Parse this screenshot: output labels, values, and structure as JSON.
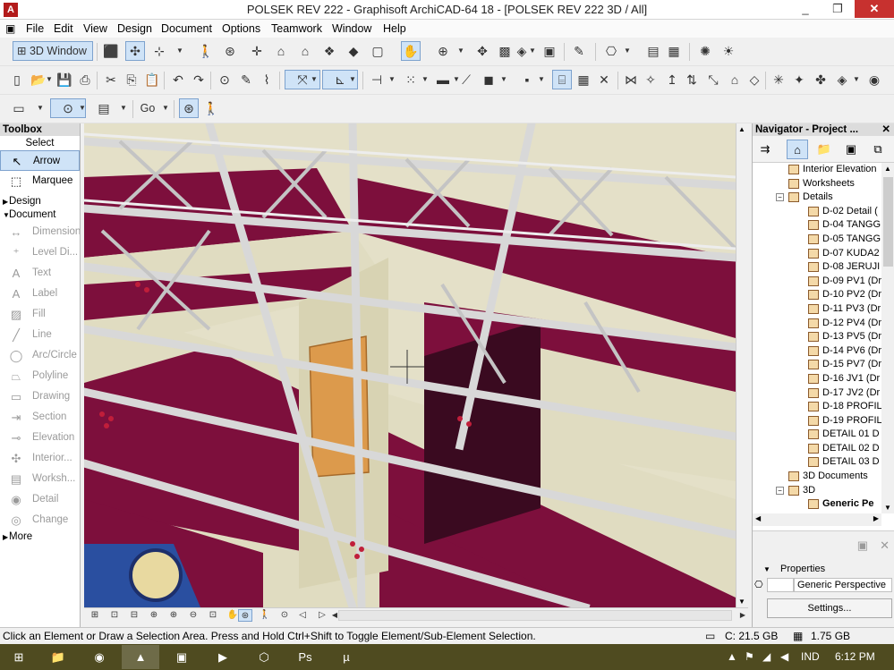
{
  "window": {
    "title": "POLSEK REV 222 - Graphisoft ArchiCAD-64 18 - [POLSEK REV 222 3D / All]",
    "app_icon": "archicad-icon",
    "controls": [
      "_",
      "❐",
      "✕"
    ]
  },
  "menu": [
    "File",
    "Edit",
    "View",
    "Design",
    "Document",
    "Options",
    "Teamwork",
    "Window",
    "Help"
  ],
  "toolbar": {
    "view_button": "3D Window",
    "go_label": "Go"
  },
  "toolbox": {
    "title": "Toolbox",
    "select_label": "Select",
    "select_tools": [
      {
        "label": "Arrow",
        "icon": "arrow-icon",
        "glyph": "↖",
        "selected": true
      },
      {
        "label": "Marquee",
        "icon": "marquee-icon",
        "glyph": "⬚",
        "selected": false
      }
    ],
    "groups": {
      "design": "Design",
      "document": "Document",
      "more": "More"
    },
    "document_tools": [
      {
        "label": "Dimension",
        "icon": "dimension-icon",
        "glyph": "↔"
      },
      {
        "label": "Level Di...",
        "icon": "level-dimension-icon",
        "glyph": "⁺"
      },
      {
        "label": "Text",
        "icon": "text-icon",
        "glyph": "A"
      },
      {
        "label": "Label",
        "icon": "label-icon",
        "glyph": "A"
      },
      {
        "label": "Fill",
        "icon": "fill-icon",
        "glyph": "▨"
      },
      {
        "label": "Line",
        "icon": "line-icon",
        "glyph": "╱"
      },
      {
        "label": "Arc/Circle",
        "icon": "circle-icon",
        "glyph": "◯"
      },
      {
        "label": "Polyline",
        "icon": "polyline-icon",
        "glyph": "⏢"
      },
      {
        "label": "Drawing",
        "icon": "drawing-icon",
        "glyph": "▭"
      },
      {
        "label": "Section",
        "icon": "section-icon",
        "glyph": "⇥"
      },
      {
        "label": "Elevation",
        "icon": "elevation-icon",
        "glyph": "⊸"
      },
      {
        "label": "Interior...",
        "icon": "interior-elevation-icon",
        "glyph": "✣"
      },
      {
        "label": "Worksh...",
        "icon": "worksheet-icon",
        "glyph": "▤"
      },
      {
        "label": "Detail",
        "icon": "detail-icon",
        "glyph": "◉"
      },
      {
        "label": "Change",
        "icon": "change-icon",
        "glyph": "◎"
      }
    ]
  },
  "navigator": {
    "title": "Navigator - Project ...",
    "tree": [
      {
        "label": "Interior Elevation",
        "level": 1,
        "toggle": ""
      },
      {
        "label": "Worksheets",
        "level": 1,
        "toggle": ""
      },
      {
        "label": "Details",
        "level": 1,
        "toggle": "−"
      },
      {
        "label": "D-02 Detail (",
        "level": 2,
        "toggle": ""
      },
      {
        "label": "D-04 TANGG",
        "level": 2,
        "toggle": ""
      },
      {
        "label": "D-05 TANGG",
        "level": 2,
        "toggle": ""
      },
      {
        "label": "D-07 KUDA2",
        "level": 2,
        "toggle": ""
      },
      {
        "label": "D-08 JERUJI",
        "level": 2,
        "toggle": ""
      },
      {
        "label": "D-09 PV1 (Dr",
        "level": 2,
        "toggle": ""
      },
      {
        "label": "D-10 PV2 (Dr",
        "level": 2,
        "toggle": ""
      },
      {
        "label": "D-11 PV3 (Dr",
        "level": 2,
        "toggle": ""
      },
      {
        "label": "D-12 PV4 (Dr",
        "level": 2,
        "toggle": ""
      },
      {
        "label": "D-13 PV5 (Dr",
        "level": 2,
        "toggle": ""
      },
      {
        "label": "D-14 PV6 (Dr",
        "level": 2,
        "toggle": ""
      },
      {
        "label": "D-15 PV7 (Dr",
        "level": 2,
        "toggle": ""
      },
      {
        "label": "D-16 JV1 (Dr",
        "level": 2,
        "toggle": ""
      },
      {
        "label": "D-17 JV2 (Dr",
        "level": 2,
        "toggle": ""
      },
      {
        "label": "D-18 PROFIL",
        "level": 2,
        "toggle": ""
      },
      {
        "label": "D-19 PROFIL",
        "level": 2,
        "toggle": ""
      },
      {
        "label": "DETAIL 01 D",
        "level": 2,
        "toggle": ""
      },
      {
        "label": "DETAIL 02 D",
        "level": 2,
        "toggle": ""
      },
      {
        "label": "DETAIL 03 D",
        "level": 2,
        "toggle": ""
      },
      {
        "label": "3D Documents",
        "level": 1,
        "toggle": ""
      },
      {
        "label": "3D",
        "level": 1,
        "toggle": "−"
      },
      {
        "label": "Generic Pe",
        "level": 2,
        "toggle": "",
        "bold": true
      }
    ],
    "properties_label": "Properties",
    "view_name": "Generic Perspective",
    "settings_button": "Settings..."
  },
  "status": {
    "message": "Click an Element or Draw a Selection Area. Press and Hold Ctrl+Shift to Toggle Element/Sub-Element Selection.",
    "disk_free": "C: 21.5 GB",
    "memory": "1.75 GB"
  },
  "taskbar": {
    "apps": [
      "file-explorer-icon",
      "firefox-icon",
      "archicad-icon",
      "powerpoint-icon",
      "media-player-icon",
      "network-icon",
      "photoshop-icon",
      "utorrent-icon"
    ],
    "language": "IND",
    "time": "6:12 PM"
  },
  "colors": {
    "beam": "#d8d8d8",
    "floor": "#7d0f3c",
    "wall": "#e0dcc1",
    "door": "#dc9a4c",
    "toolbar_active": "#cfe3f7"
  }
}
